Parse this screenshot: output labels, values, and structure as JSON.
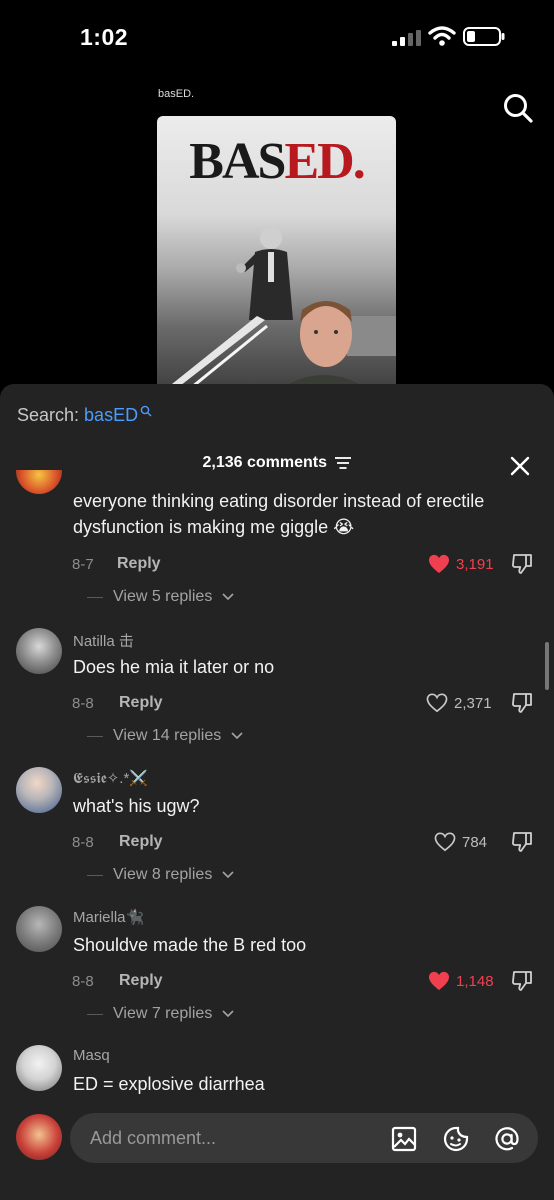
{
  "status_bar": {
    "time": "1:02"
  },
  "video": {
    "caption": "basED.",
    "thumb_title_dark": "BAS",
    "thumb_title_red": "ED.",
    "thumb_title_dot": "."
  },
  "search": {
    "prefix": "Search: ",
    "term": "basED"
  },
  "comments_header": {
    "count_label": "2,136 comments"
  },
  "comments": [
    {
      "username": "",
      "text": "everyone thinking eating disorder instead of erectile dysfunction is making me giggle 😭",
      "date": "8-7",
      "reply_label": "Reply",
      "likes": "3,191",
      "liked": true,
      "view_replies": "View 5 replies"
    },
    {
      "username": "Natilla 击",
      "text": "Does he mia it later or no",
      "date": "8-8",
      "reply_label": "Reply",
      "likes": "2,371",
      "liked": false,
      "view_replies": "View 14 replies"
    },
    {
      "username": "𝕰𝖘𝖘𝖎𝖊✧.*⚔️",
      "text": "what's his ugw?",
      "date": "8-8",
      "reply_label": "Reply",
      "likes": "784",
      "liked": false,
      "view_replies": "View 8 replies"
    },
    {
      "username": "Mariella🐈‍⬛",
      "text": "Shouldve made the B red too",
      "date": "8-8",
      "reply_label": "Reply",
      "likes": "1,148",
      "liked": true,
      "view_replies": "View 7 replies"
    },
    {
      "username": "Masq",
      "text": "ED = explosive diarrhea"
    }
  ],
  "composer": {
    "placeholder": "Add comment..."
  },
  "colors": {
    "accent_blue": "#4b9cff",
    "like_red": "#f0404f",
    "sheet_bg": "#232323"
  },
  "icons": [
    "search-icon",
    "close-icon",
    "filter-icon",
    "heart-icon",
    "dislike-icon",
    "chevron-down-icon",
    "image-icon",
    "emoji-icon",
    "mention-icon"
  ]
}
